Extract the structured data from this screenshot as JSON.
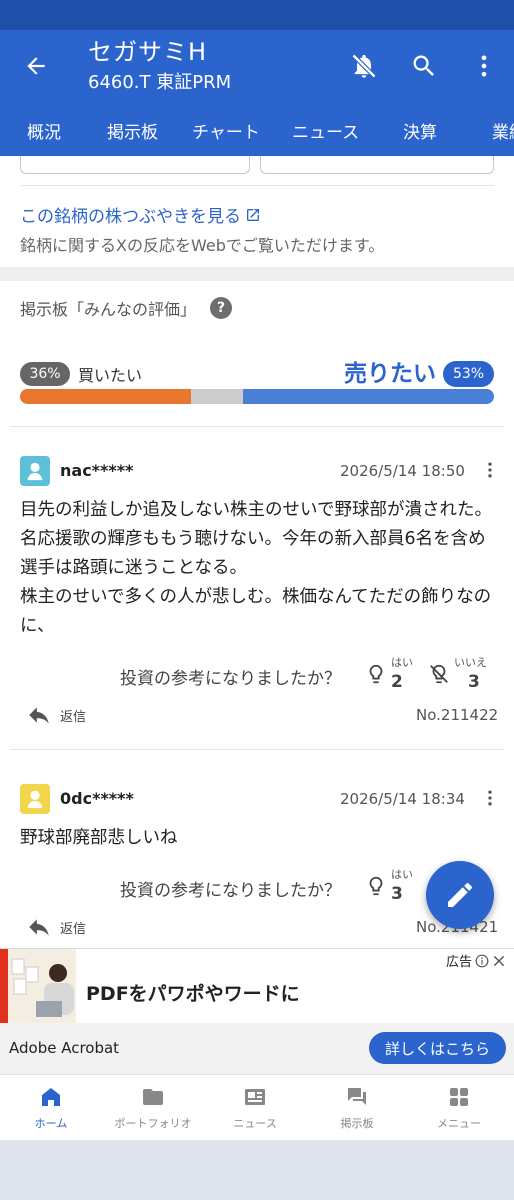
{
  "header": {
    "stock_name": "セガサミH",
    "stock_code": "6460.T 東証PRM",
    "tabs": [
      "概況",
      "掲示板",
      "チャート",
      "ニュース",
      "決算",
      "業績"
    ],
    "active_tab": "掲示板"
  },
  "tsubuyaki": {
    "link": "この銘柄の株つぶやきを見る",
    "sub": "銘柄に関するXの反応をWebでご覧いただけます。"
  },
  "board": {
    "title": "掲示板「みんなの評価」",
    "help": "?",
    "buy_percent_label": "36%",
    "buy_label": "買いたい",
    "sell_label": "売りたい",
    "sell_percent_label": "53%",
    "ratio": {
      "buy": 36,
      "neutral": 11,
      "sell": 53
    }
  },
  "posts": [
    {
      "author": "nac*****",
      "date": "2026/5/14 18:50",
      "body": "目先の利益しか追及しない株主のせいで野球部が潰された。名応援歌の輝彦ももう聴けない。今年の新入部員6名を含め選手は路頭に迷うことなる。\n株主のせいで多くの人が悲しむ。株価なんてただの飾りなのに、",
      "helpful_question": "投資の参考になりましたか？",
      "yes_label": "はい",
      "yes_count": "2",
      "no_label": "いいえ",
      "no_count": "3",
      "reply_label": "返信",
      "post_no": "No.211422",
      "avatar_color": "#5bc0d8"
    },
    {
      "author": "0dc*****",
      "date": "2026/5/14 18:34",
      "body": "野球部廃部悲しいね",
      "helpful_question": "投資の参考になりましたか？",
      "yes_label": "はい",
      "yes_count": "3",
      "reply_label": "返信",
      "post_no": "No.211421",
      "avatar_color": "#f2d54a"
    }
  ],
  "ad": {
    "headline": "PDFをパワポやワードに",
    "tag": "広告",
    "advertiser": "Adobe Acrobat",
    "cta": "詳しくはこちら"
  },
  "bottom_nav": [
    {
      "label": "ホーム",
      "icon": "home-icon",
      "active": true
    },
    {
      "label": "ポートフォリオ",
      "icon": "folder-icon",
      "active": false
    },
    {
      "label": "ニュース",
      "icon": "news-icon",
      "active": false
    },
    {
      "label": "掲示板",
      "icon": "chat-icon",
      "active": false
    },
    {
      "label": "メニュー",
      "icon": "grid-icon",
      "active": false
    }
  ],
  "colors": {
    "brand": "#2b64cc",
    "buy": "#e8762e",
    "sell": "#4a7fd6"
  }
}
